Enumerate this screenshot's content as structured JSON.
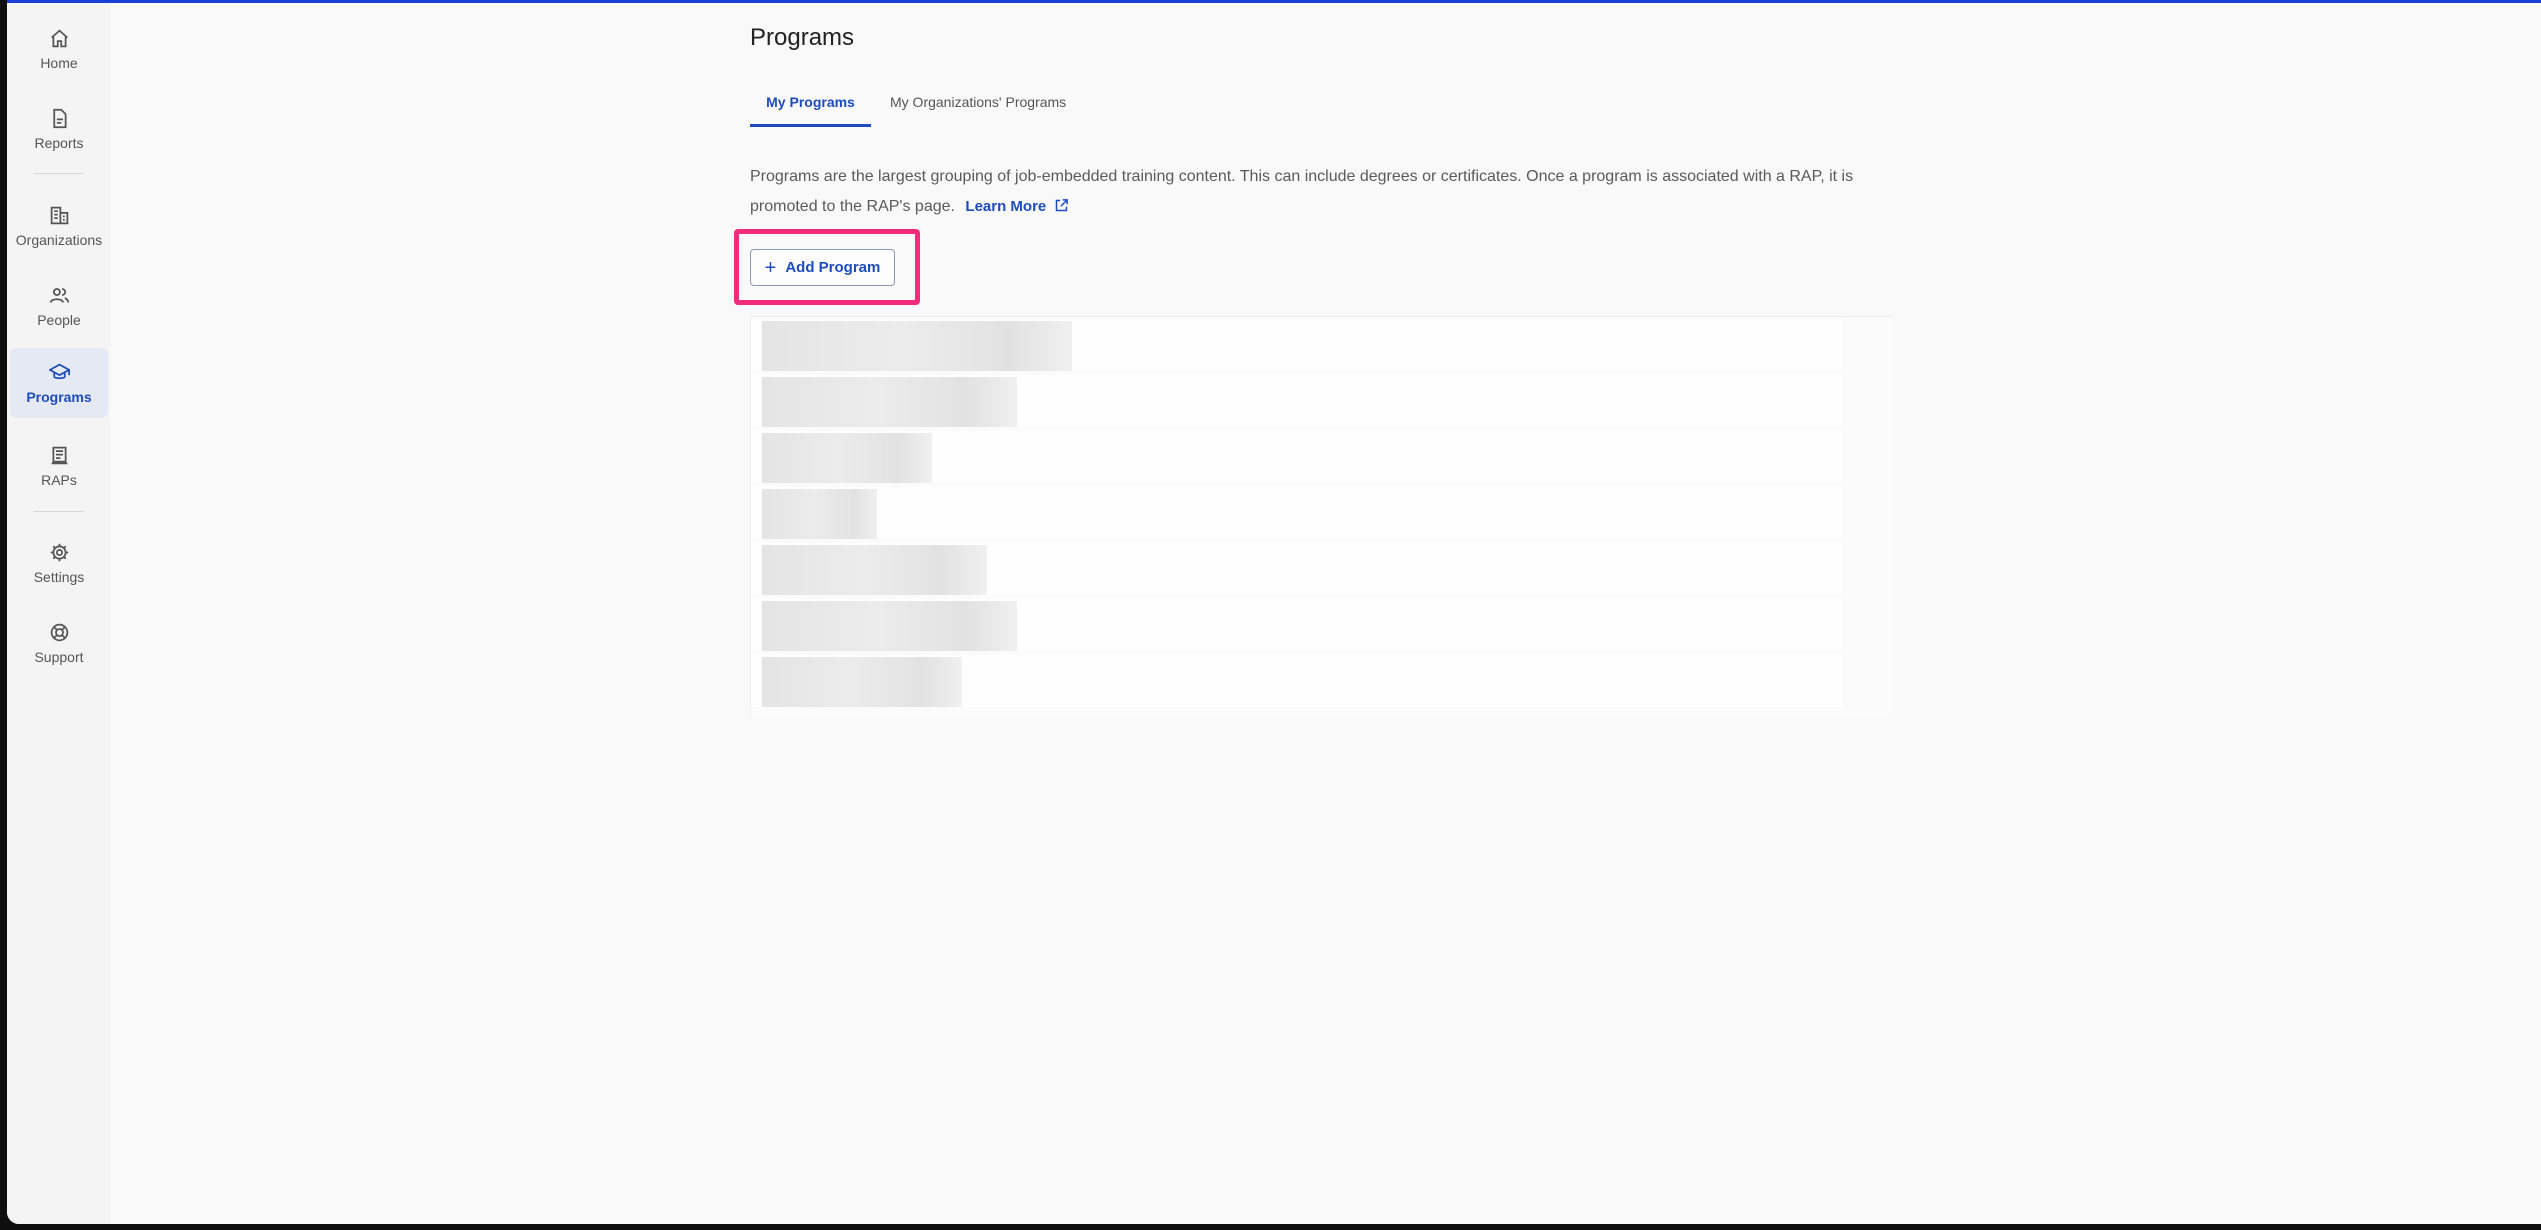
{
  "sidebar": {
    "items": [
      {
        "label": "Home",
        "icon": "home-icon"
      },
      {
        "label": "Reports",
        "icon": "document-icon"
      },
      {
        "label": "Organizations",
        "icon": "building-icon"
      },
      {
        "label": "People",
        "icon": "people-icon"
      },
      {
        "label": "Programs",
        "icon": "graduation-cap-icon",
        "active": true
      },
      {
        "label": "RAPs",
        "icon": "certificate-icon"
      },
      {
        "label": "Settings",
        "icon": "gear-icon"
      },
      {
        "label": "Support",
        "icon": "lifebuoy-icon"
      }
    ]
  },
  "page": {
    "title": "Programs",
    "tabs": [
      {
        "label": "My Programs",
        "active": true
      },
      {
        "label": "My Organizations' Programs",
        "active": false
      }
    ],
    "description": "Programs are the largest grouping of job-embedded training content. This can include degrees or certificates. Once a program is associated with a RAP, it is promoted to the RAP's page.",
    "learn_more_label": "Learn More",
    "add_button_label": "Add Program"
  },
  "colors": {
    "accent": "#1d4cbd",
    "highlight": "#f02c7b",
    "top_bar": "#1a3fd6"
  }
}
